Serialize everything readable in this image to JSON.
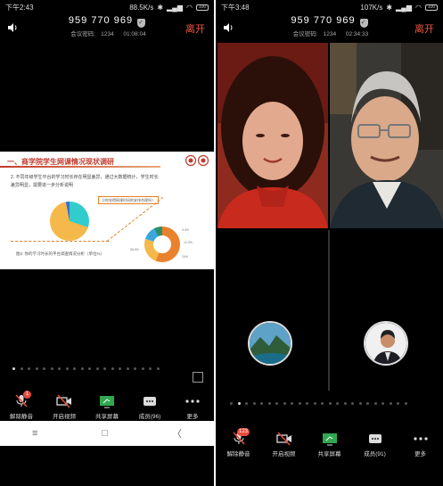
{
  "left": {
    "status": {
      "time": "下午2:43",
      "net": "88.5K/s",
      "battery": "100"
    },
    "meeting": {
      "id": "959 770 969",
      "code_label": "会议密码:",
      "code": "1234",
      "timer": "01:08:04",
      "leave": "离开"
    },
    "slide": {
      "title": "一、商学院学生网课情况现状调研",
      "text": "2. 不同年级学生平台的学习时长存在明显差异，通过大数据统计，学生时长差异明显，需要进一步分析说明",
      "question_box": "③你觉得网课时间的安排合理吗?",
      "footer": "图2: 你的学习时长的平台调查情况分析（单位%）",
      "donut_labels": [
        "3.3%",
        "12.3%",
        "24%",
        "55.9%"
      ]
    },
    "pager": {
      "count": 20,
      "active": 0
    },
    "toolbar": [
      {
        "label": "解除静音",
        "icon": "mic-muted-icon"
      },
      {
        "label": "开启视频",
        "icon": "camera-off-icon"
      },
      {
        "label": "共享屏幕",
        "icon": "share-screen-icon"
      },
      {
        "label": "成员(96)",
        "icon": "members-icon",
        "badge": "1"
      },
      {
        "label": "更多",
        "icon": "more-icon"
      }
    ]
  },
  "right": {
    "status": {
      "time": "下午3:48",
      "net": "107K/s",
      "battery": "100"
    },
    "meeting": {
      "id": "959 770 969",
      "code_label": "会议密码:",
      "code": "1234",
      "timer": "02:34:33",
      "leave": "离开"
    },
    "pager": {
      "count": 24,
      "active": 1
    },
    "toolbar": [
      {
        "label": "解除静音",
        "icon": "mic-muted-icon"
      },
      {
        "label": "开启视频",
        "icon": "camera-off-icon"
      },
      {
        "label": "共享屏幕",
        "icon": "share-screen-icon"
      },
      {
        "label": "成员(91)",
        "icon": "members-icon",
        "badge": "123"
      },
      {
        "label": "更多",
        "icon": "more-icon"
      }
    ]
  },
  "nav": {
    "menu": "≡",
    "home": "□",
    "back": "〈"
  }
}
